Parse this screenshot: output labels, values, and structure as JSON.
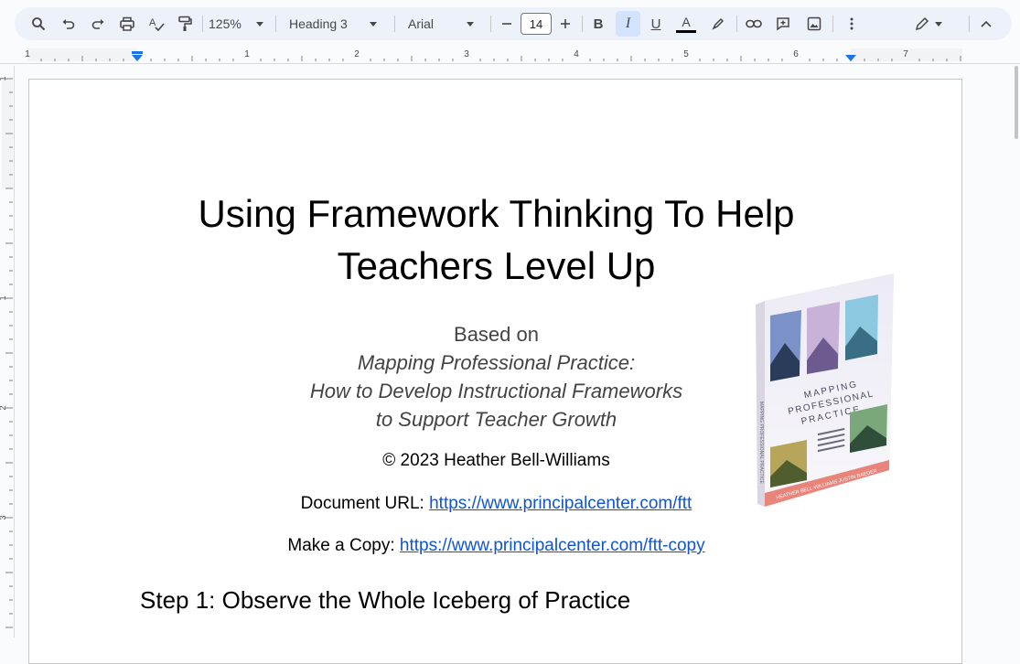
{
  "toolbar": {
    "zoom": "125%",
    "style": "Heading 3",
    "font": "Arial",
    "font_size": "14",
    "icons": [
      "search-icon",
      "undo-icon",
      "redo-icon",
      "print-icon",
      "spellcheck-icon",
      "paint-format-icon",
      "decrease-font-icon",
      "increase-font-icon",
      "bold-icon",
      "italic-icon",
      "underline-icon",
      "text-color-icon",
      "highlight-icon",
      "link-icon",
      "comment-icon",
      "image-icon",
      "more-icon",
      "edit-mode-icon",
      "collapse-icon"
    ],
    "bold_label": "B",
    "italic_label": "I",
    "underline_label": "U",
    "text_color_label": "A",
    "text_color": "#000000"
  },
  "ruler": {
    "marks": [
      "1",
      "1",
      "2",
      "3",
      "4",
      "5",
      "6",
      "7"
    ],
    "vmarks": [
      "1",
      "1",
      "2",
      "3"
    ],
    "accent": "#1a73e8"
  },
  "document": {
    "title_line1": "Using Framework Thinking To Help",
    "title_line2": "Teachers Level Up",
    "based_on": "Based on",
    "book_line1": "Mapping Professional Practice:",
    "book_line2": "How to Develop Instructional Frameworks",
    "book_line3": "to Support Teacher Growth",
    "copyright": "© 2023 Heather Bell-Williams",
    "doc_url_label": "Document URL: ",
    "doc_url": "https://www.principalcenter.com/ftt",
    "copy_label": "Make a Copy: ",
    "copy_url": "https://www.principalcenter.com/ftt-copy",
    "step1": "Step 1: Observe the Whole Iceberg of Practice"
  },
  "book_cover": {
    "title": "MAPPING PROFESSIONAL PRACTICE",
    "spine": "MAPPING PROFESSIONAL PRACTICE",
    "authors": "HEATHER BELL-WILLIAMS   JUSTIN BAEDER",
    "subtitle": "How to Develop Instructional Frameworks to Support Teacher Growth"
  }
}
